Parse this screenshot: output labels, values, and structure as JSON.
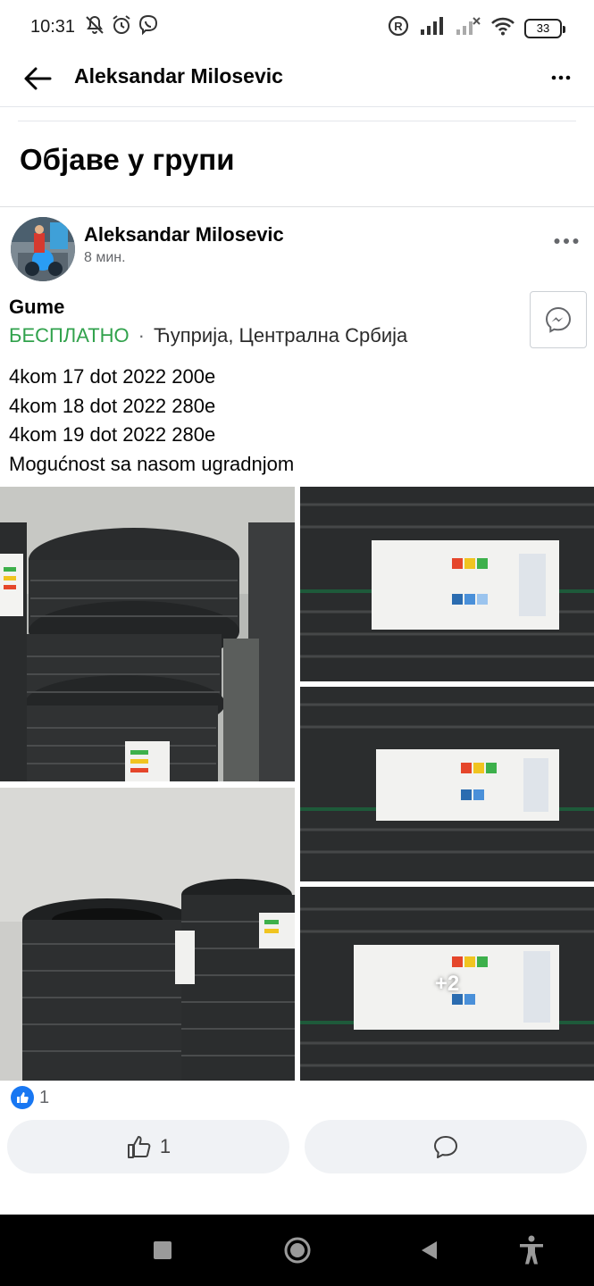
{
  "status": {
    "time": "10:31",
    "battery": "33"
  },
  "header": {
    "title": "Aleksandar Milosevic"
  },
  "section": {
    "title": "Објаве у групи"
  },
  "post": {
    "author": "Aleksandar Milosevic",
    "time": "8 мин.",
    "item_title": "Gume",
    "price": "БЕСПЛАТНО",
    "separator": "·",
    "location": "Ћуприја, Централна Србија",
    "lines": [
      "4kom 17 dot 2022 200e",
      "4kom 18 dot 2022 280e",
      "4kom 19 dot 2022 280e",
      "Mogućnost sa nasom ugradnjom"
    ],
    "more_photos": "+2",
    "reaction_count": "1",
    "like_count": "1"
  },
  "colors": {
    "price_green": "#31a24c",
    "facebook_blue": "#1877f2",
    "button_bg": "#f0f2f5"
  },
  "icons": {
    "back": "arrow-left-icon",
    "more": "more-horizontal-icon",
    "messenger": "messenger-icon",
    "like": "thumbs-up-icon",
    "comment": "comment-icon"
  }
}
